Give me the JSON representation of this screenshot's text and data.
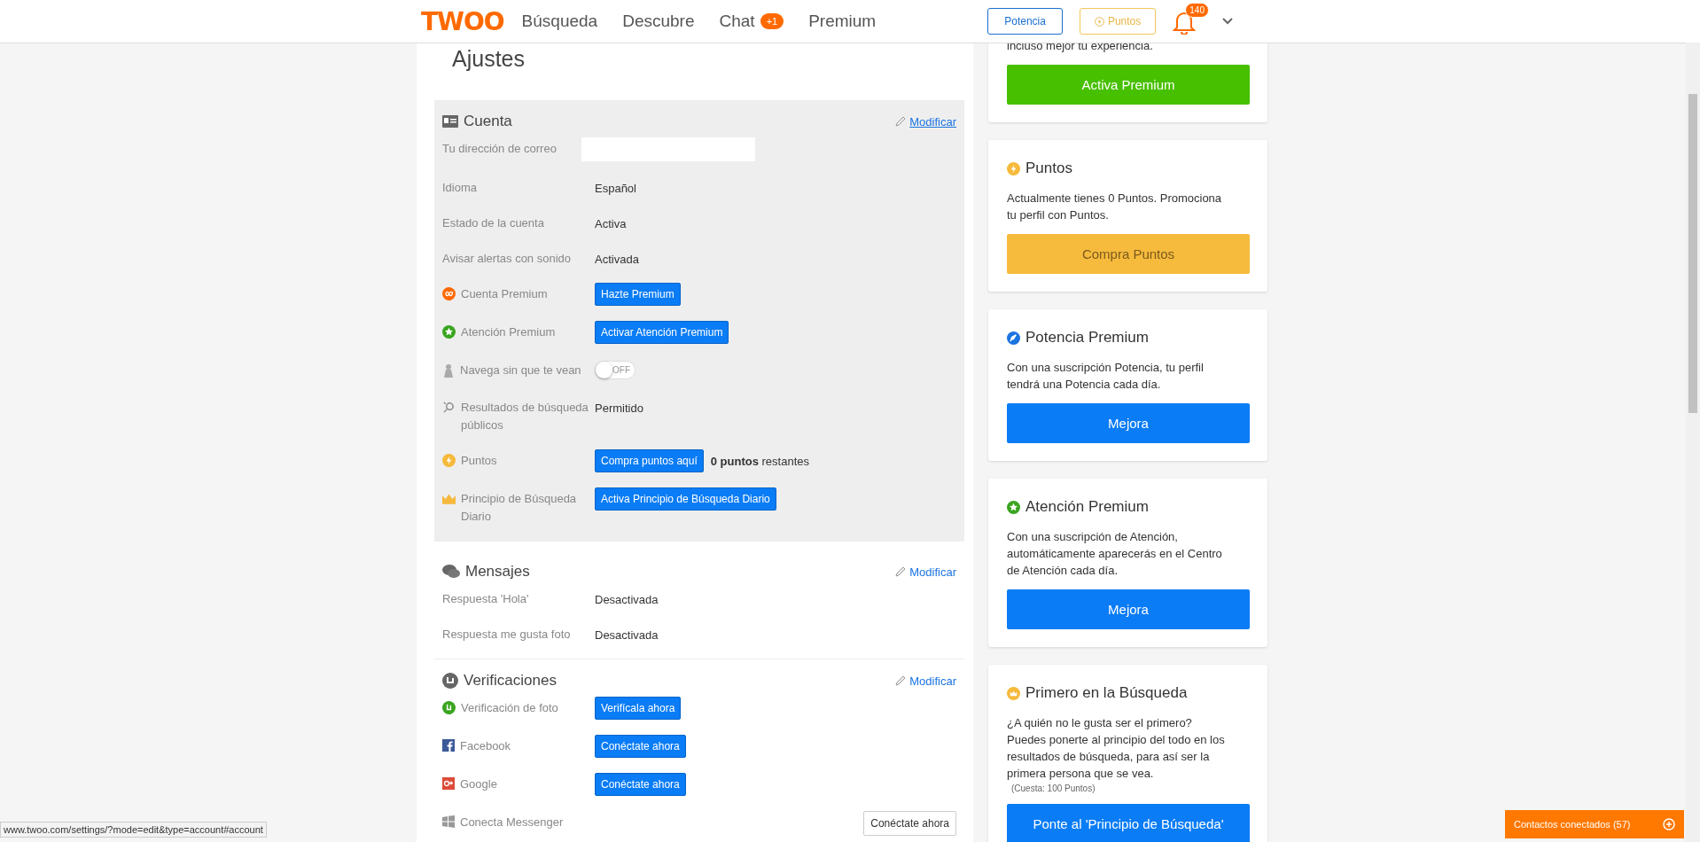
{
  "header": {
    "logo": "TWOO",
    "nav": [
      {
        "label": "Búsqueda"
      },
      {
        "label": "Descubre"
      },
      {
        "label": "Chat",
        "badge": "+1"
      },
      {
        "label": "Premium"
      }
    ],
    "buttons": [
      {
        "label": "Potencia",
        "kind": "potencia"
      },
      {
        "label": "Puntos",
        "kind": "puntos"
      }
    ],
    "notifications": "140"
  },
  "settings": {
    "title": "Ajustes",
    "sections": [
      {
        "title": "Cuenta",
        "edit": "Modificar",
        "highlighted": true,
        "rows": [
          {
            "kind": "input",
            "label": "Tu dirección de correo"
          },
          {
            "kind": "text",
            "label": "Idioma",
            "value": "Español"
          },
          {
            "kind": "text",
            "label": "Estado de la cuenta",
            "value": "Activa"
          },
          {
            "kind": "text",
            "label": "Avisar alertas con sonido",
            "value": "Activada"
          },
          {
            "kind": "button",
            "label": "Cuenta Premium",
            "button": "Hazte Premium"
          },
          {
            "kind": "button",
            "label": "Atención Premium",
            "button": "Activar Atención Premium"
          },
          {
            "kind": "toggle",
            "label": "Navega sin que te vean",
            "on": false,
            "toggle_label": "OFF"
          },
          {
            "kind": "text",
            "label": "Resultados de búsqueda públicos",
            "value": "Permitido"
          },
          {
            "kind": "button",
            "label": "Puntos",
            "button": "Compra puntos aquí",
            "note": "**0 puntos** restantes"
          },
          {
            "kind": "button",
            "label": "Principio de Búsqueda Diario",
            "button": "Activa Principio de Búsqueda Diario"
          }
        ]
      },
      {
        "title": "Mensajes",
        "edit": "Modificar",
        "highlighted": false,
        "rows": [
          {
            "kind": "text",
            "label": "Respuesta 'Hola'",
            "value": "Desactivada"
          },
          {
            "kind": "text",
            "label": "Respuesta me gusta foto",
            "value": "Desactivada"
          }
        ]
      },
      {
        "title": "Verificaciones",
        "edit": "Modificar",
        "highlighted": false,
        "rows": [
          {
            "kind": "button",
            "label": "Verificación de foto",
            "button": "Verifícala ahora"
          },
          {
            "kind": "button",
            "label": "Facebook",
            "button": "Conéctate ahora"
          },
          {
            "kind": "button",
            "label": "Google",
            "button": "Conéctate ahora"
          },
          {
            "kind": "outline",
            "label": "Conecta Messenger",
            "button": "Conéctate ahora"
          }
        ]
      }
    ]
  },
  "promo_cards": [
    {
      "kind": "premium",
      "text": "incluso mejor tu experiencia.",
      "button": "Activa Premium"
    },
    {
      "kind": "puntos",
      "title": "Puntos",
      "text": "Actualmente tienes 0 Puntos. Promociona tu perfil con Puntos.",
      "button": "Compra Puntos"
    },
    {
      "kind": "upgrade",
      "title": "Potencia Premium",
      "text": "Con una suscripción Potencia, tu perfil tendrá una Potencia cada día.",
      "button": "Mejora"
    },
    {
      "kind": "upgrade",
      "title": "Atención Premium",
      "text": "Con una suscripción de Atención, automáticamente aparecerás en el Centro de Atención cada día.",
      "button": "Mejora"
    },
    {
      "kind": "upgrade",
      "title": "Primero en la Búsqueda",
      "text": "¿A quién no le gusta ser el primero? Puedes ponerte al principio del todo en los resultados de búsqueda, para así ser la primera persona que se vea.",
      "note": "(Cuesta: 100 Puntos)",
      "button": "Ponte al 'Principio de Búsqueda'"
    }
  ],
  "contacts_tab": "Contactos conectados (57)",
  "status_url": "www.twoo.com/settings/?mode=edit&type=account#account"
}
